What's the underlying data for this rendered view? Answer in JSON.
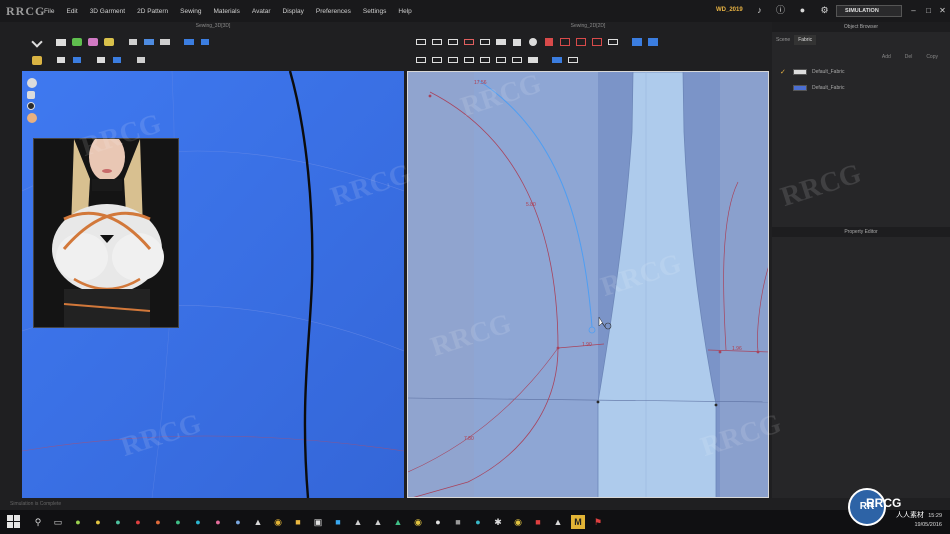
{
  "app": {
    "logo": "RRCG",
    "file_name": "WD_2019"
  },
  "menu": {
    "items": [
      "File",
      "Edit",
      "3D Garment",
      "2D Pattern",
      "Sewing",
      "Materials",
      "Avatar",
      "Display",
      "Preferences",
      "Settings",
      "Help"
    ]
  },
  "topbar": {
    "simulation_label": "SIMULATION",
    "icons": [
      "volume-icon",
      "info-icon",
      "user-icon",
      "settings-icon",
      "cart-icon"
    ]
  },
  "views": {
    "left_title": "Sewing_3D[3D]",
    "right_title": "Sewing_2D[2D]"
  },
  "pattern_labels": {
    "label_1": "17.56",
    "label_2": "5.80",
    "label_3": "1.90",
    "label_4": "7.80",
    "label_5": "1.96"
  },
  "right_panel": {
    "object_browser_title": "Object Browser",
    "tabs": [
      "Scene",
      "Fabric"
    ],
    "sub_actions": [
      "Add",
      "Del",
      "Copy"
    ],
    "fabrics": [
      {
        "name": "Default_Fabric",
        "checked": true,
        "color": "#dcdcdc"
      },
      {
        "name": "Default_Fabric",
        "checked": false,
        "color": "#4b6ed2"
      }
    ],
    "property_editor_title": "Property Editor"
  },
  "status": {
    "text": "Simulation is Complete"
  },
  "taskbar": {
    "time": "15:29",
    "date": "19/05/2016"
  },
  "watermark": {
    "brand": "RRCG",
    "sub": "人人素材",
    "tile": "RRCG"
  },
  "colors": {
    "viewport_3d_bg": "#3c73ea",
    "viewport_2d_bg": "#7b94c8",
    "pattern_piece": "#aecbec",
    "accent": "#e8b343"
  }
}
